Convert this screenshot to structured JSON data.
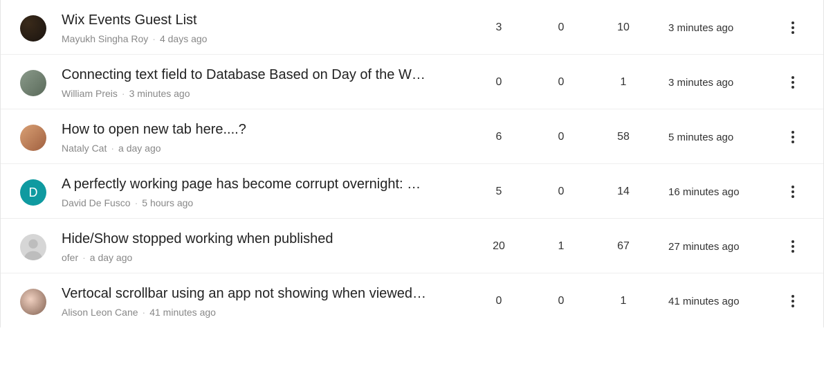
{
  "rows": [
    {
      "title": "Wix Events Guest List",
      "author": "Mayukh Singha Roy",
      "posted": "4 days ago",
      "col1": "3",
      "col2": "0",
      "col3": "10",
      "activity": "3 minutes ago",
      "avatar_type": "photo",
      "avatar_class": "av-photo-1",
      "avatar_letter": ""
    },
    {
      "title": "Connecting text field to Database Based on Day of the W…",
      "author": "William Preis",
      "posted": "3 minutes ago",
      "col1": "0",
      "col2": "0",
      "col3": "1",
      "activity": "3 minutes ago",
      "avatar_type": "photo",
      "avatar_class": "av-photo-2",
      "avatar_letter": ""
    },
    {
      "title": "How to open new tab here....?",
      "author": "Nataly Cat",
      "posted": "a day ago",
      "col1": "6",
      "col2": "0",
      "col3": "58",
      "activity": "5 minutes ago",
      "avatar_type": "photo",
      "avatar_class": "av-photo-3",
      "avatar_letter": ""
    },
    {
      "title": "A perfectly working page has become corrupt overnight: …",
      "author": "David De Fusco",
      "posted": "5 hours ago",
      "col1": "5",
      "col2": "0",
      "col3": "14",
      "activity": "16 minutes ago",
      "avatar_type": "letter",
      "avatar_class": "av-letter-d",
      "avatar_letter": "D"
    },
    {
      "title": "Hide/Show stopped working when published",
      "author": "ofer",
      "posted": "a day ago",
      "col1": "20",
      "col2": "1",
      "col3": "67",
      "activity": "27 minutes ago",
      "avatar_type": "silhouette",
      "avatar_class": "av-gray",
      "avatar_letter": ""
    },
    {
      "title": "Vertocal scrollbar using an app not showing when viewed…",
      "author": "Alison Leon Cane",
      "posted": "41 minutes ago",
      "col1": "0",
      "col2": "0",
      "col3": "1",
      "activity": "41 minutes ago",
      "avatar_type": "photo",
      "avatar_class": "av-photo-6",
      "avatar_letter": ""
    }
  ],
  "dot": "·"
}
